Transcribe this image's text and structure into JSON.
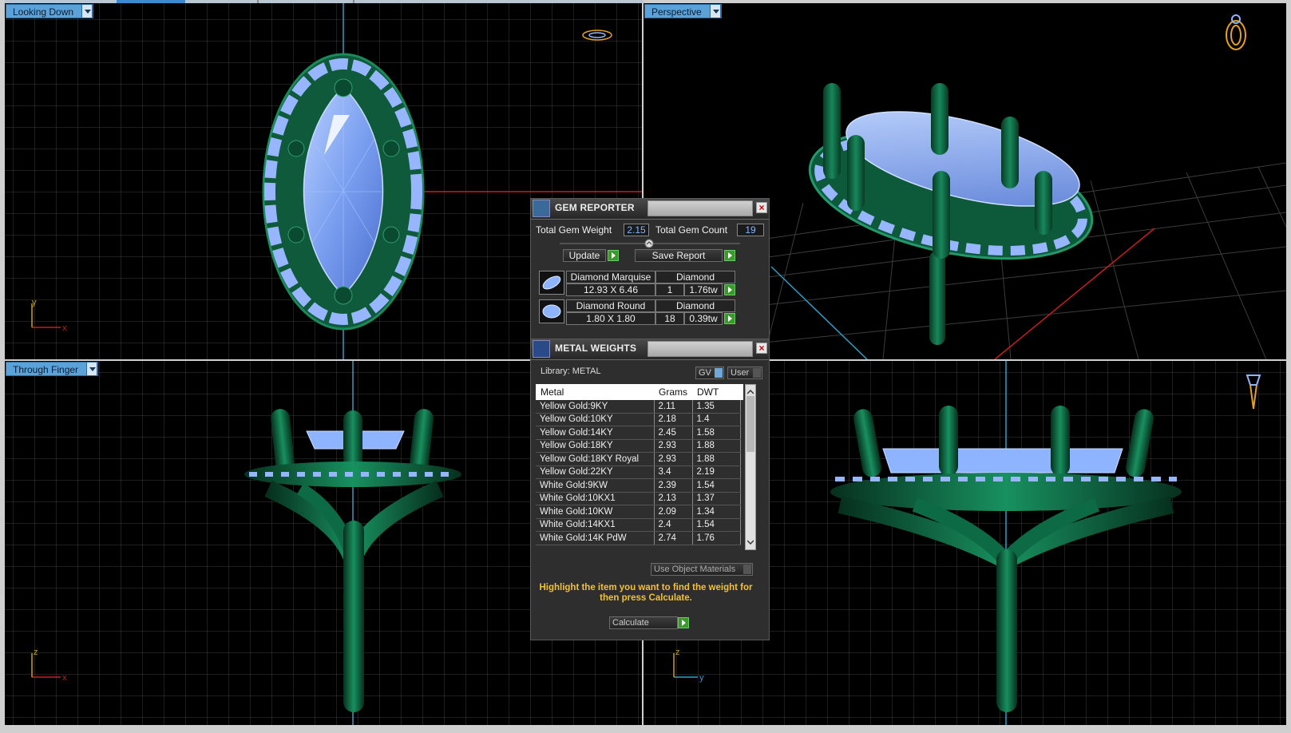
{
  "viewports": {
    "top_left": {
      "label": "Looking Down"
    },
    "top_right": {
      "label": "Perspective"
    },
    "bottom_left": {
      "label": "Through Finger"
    },
    "bottom_right": {
      "label": ""
    }
  },
  "axes": {
    "x": "x",
    "y": "y",
    "z": "z"
  },
  "gem_reporter": {
    "title": "GEM REPORTER",
    "total_weight_label": "Total Gem Weight",
    "total_weight": "2.15",
    "total_count_label": "Total Gem Count",
    "total_count": "19",
    "update_label": "Update",
    "save_label": "Save Report",
    "gems": [
      {
        "name": "Diamond Marquise",
        "material": "Diamond",
        "size": "12.93 X 6.46",
        "count": "1",
        "weight": "1.76tw"
      },
      {
        "name": "Diamond Round",
        "material": "Diamond",
        "size": "1.80 X 1.80",
        "count": "18",
        "weight": "0.39tw"
      }
    ]
  },
  "metal_weights": {
    "title": "METAL WEIGHTS",
    "library": "Library: METAL",
    "gv_label": "GV",
    "user_label": "User",
    "columns": [
      "Metal",
      "Grams",
      "DWT"
    ],
    "rows": [
      [
        "Yellow Gold:9KY",
        "2.11",
        "1.35"
      ],
      [
        "Yellow Gold:10KY",
        "2.18",
        "1.4"
      ],
      [
        "Yellow Gold:14KY",
        "2.45",
        "1.58"
      ],
      [
        "Yellow Gold:18KY",
        "2.93",
        "1.88"
      ],
      [
        "Yellow Gold:18KY Royal",
        "2.93",
        "1.88"
      ],
      [
        "Yellow Gold:22KY",
        "3.4",
        "2.19"
      ],
      [
        "White Gold:9KW",
        "2.39",
        "1.54"
      ],
      [
        "White Gold:10KX1",
        "2.13",
        "1.37"
      ],
      [
        "White Gold:10KW",
        "2.09",
        "1.34"
      ],
      [
        "White Gold:14KX1",
        "2.4",
        "1.54"
      ],
      [
        "White Gold:14K PdW",
        "2.74",
        "1.76"
      ]
    ],
    "use_object_materials": "Use Object Materials",
    "hint": "Highlight the item you want to find the weight for then press Calculate.",
    "calculate_label": "Calculate"
  },
  "colors": {
    "metal": "#0f6b45",
    "gem": "#8fb4ff",
    "grid": "#4a4a4a",
    "accent_tab": "#5aa2d8",
    "ring_icon": "#e6a21a"
  }
}
